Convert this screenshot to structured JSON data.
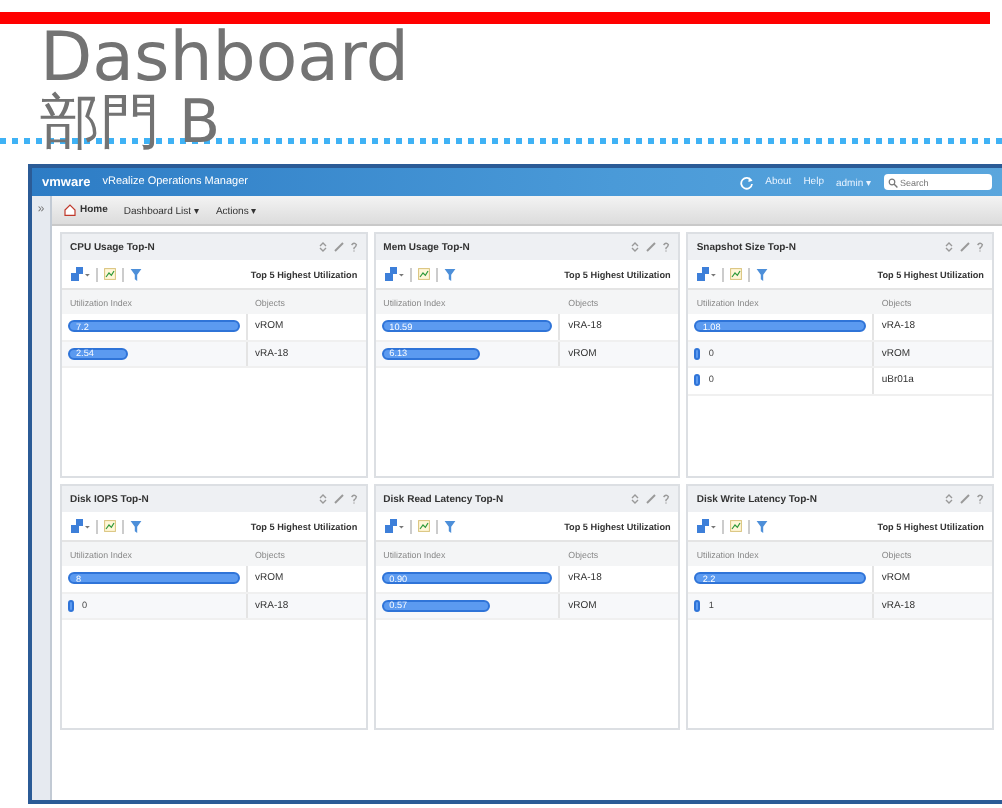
{
  "slide": {
    "title": "Dashboard",
    "subtitle": "部門 B"
  },
  "app": {
    "logo": "vmware",
    "product": "vRealize Operations Manager",
    "links": [
      "About",
      "Help",
      "admin ▾"
    ],
    "search": {
      "placeholder": "Search"
    },
    "rail_toggle": "»",
    "toolbar": [
      {
        "kind": "home",
        "label": "Home"
      },
      {
        "kind": "menu",
        "label": "Dashboard List ▾"
      },
      {
        "kind": "menu",
        "label": "Actions ▾"
      }
    ],
    "widgets": [
      {
        "title": "CPU Usage Top-N",
        "caption": "Top 5 Highest Utilization",
        "columns": [
          "Utilization Index",
          "Objects"
        ],
        "rows": [
          {
            "value": "7.2",
            "level": 1.0,
            "object": "vROM"
          },
          {
            "value": "2.54",
            "level": 0.35,
            "object": "vRA-18"
          }
        ]
      },
      {
        "title": "Mem Usage Top-N",
        "caption": "Top 5 Highest Utilization",
        "columns": [
          "Utilization Index",
          "Objects"
        ],
        "rows": [
          {
            "value": "10.59",
            "level": 1.0,
            "object": "vRA-18"
          },
          {
            "value": "6.13",
            "level": 0.58,
            "object": "vROM"
          }
        ]
      },
      {
        "title": "Snapshot Size Top-N",
        "caption": "Top 5 Highest Utilization",
        "columns": [
          "Utilization Index",
          "Objects"
        ],
        "rows": [
          {
            "value": "1.08",
            "level": 1.0,
            "object": "vRA-18"
          },
          {
            "value": "0",
            "level": 0.03,
            "object": "vROM"
          },
          {
            "value": "0",
            "level": 0.03,
            "object": "uBr01a"
          }
        ]
      },
      {
        "title": "Disk IOPS Top-N",
        "caption": "Top 5 Highest Utilization",
        "columns": [
          "Utilization Index",
          "Objects"
        ],
        "rows": [
          {
            "value": "8",
            "level": 1.0,
            "object": "vROM"
          },
          {
            "value": "0",
            "level": 0.03,
            "object": "vRA-18"
          }
        ]
      },
      {
        "title": "Disk Read Latency Top-N",
        "caption": "Top 5 Highest Utilization",
        "columns": [
          "Utilization Index",
          "Objects"
        ],
        "rows": [
          {
            "value": "0.90",
            "level": 1.0,
            "object": "vRA-18"
          },
          {
            "value": "0.57",
            "level": 0.63,
            "object": "vROM"
          }
        ]
      },
      {
        "title": "Disk Write Latency Top-N",
        "caption": "Top 5 Highest Utilization",
        "columns": [
          "Utilization Index",
          "Objects"
        ],
        "rows": [
          {
            "value": "2.2",
            "level": 1.0,
            "object": "vROM"
          },
          {
            "value": "1",
            "level": 0.03,
            "object": "vRA-18"
          }
        ]
      }
    ]
  }
}
